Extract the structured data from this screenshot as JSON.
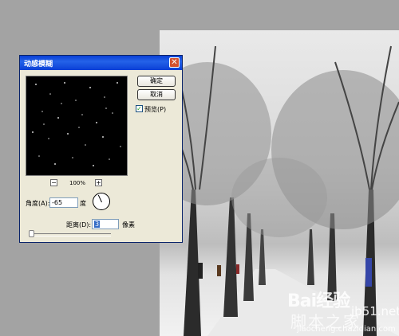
{
  "dialog": {
    "title": "动感模糊",
    "close_label": "✕",
    "ok_label": "确定",
    "cancel_label": "取消",
    "preview_checkbox_label": "预览(P)",
    "preview_checked": true,
    "zoom_minus": "−",
    "zoom_plus": "+",
    "zoom_level": "100%",
    "angle_label": "角度(A):",
    "angle_value": "-65",
    "angle_unit": "度",
    "distance_label": "距离(D):",
    "distance_value": "3",
    "distance_unit": "像素",
    "distance_slider_value": 3
  },
  "watermarks": {
    "baidu": "Bai经验",
    "jb51": "jb51.net",
    "cn_text": "脚本之家",
    "url": "jiaocheng.chazidian.com"
  },
  "icons": {
    "close": "close-icon",
    "check": "check-icon",
    "zoom_out": "zoom-out-icon",
    "zoom_in": "zoom-in-icon",
    "angle_dial": "angle-dial-icon"
  },
  "colors": {
    "titlebar": "#0a3fd6",
    "dialog_bg": "#ece9d8",
    "close_button": "#d5522e",
    "selection": "#316ac5",
    "canvas_bg": "#a3a3a3"
  }
}
